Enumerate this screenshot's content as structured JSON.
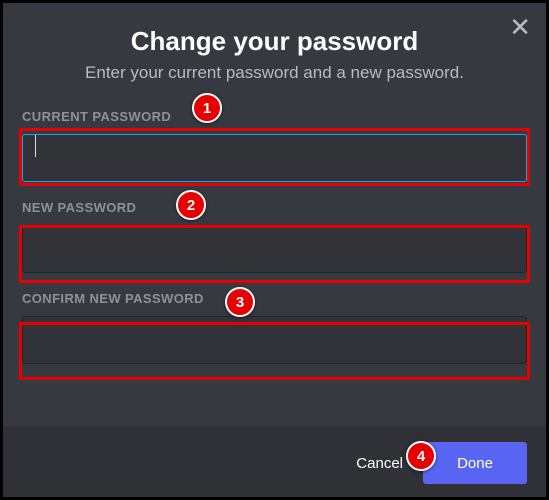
{
  "modal": {
    "title": "Change your password",
    "subtitle": "Enter your current password and a new password.",
    "fields": {
      "current": {
        "label": "CURRENT PASSWORD",
        "value": ""
      },
      "new": {
        "label": "NEW PASSWORD",
        "value": ""
      },
      "confirm": {
        "label": "CONFIRM NEW PASSWORD",
        "value": ""
      }
    },
    "buttons": {
      "cancel": "Cancel",
      "done": "Done"
    }
  },
  "callouts": {
    "n1": "1",
    "n2": "2",
    "n3": "3",
    "n4": "4"
  }
}
